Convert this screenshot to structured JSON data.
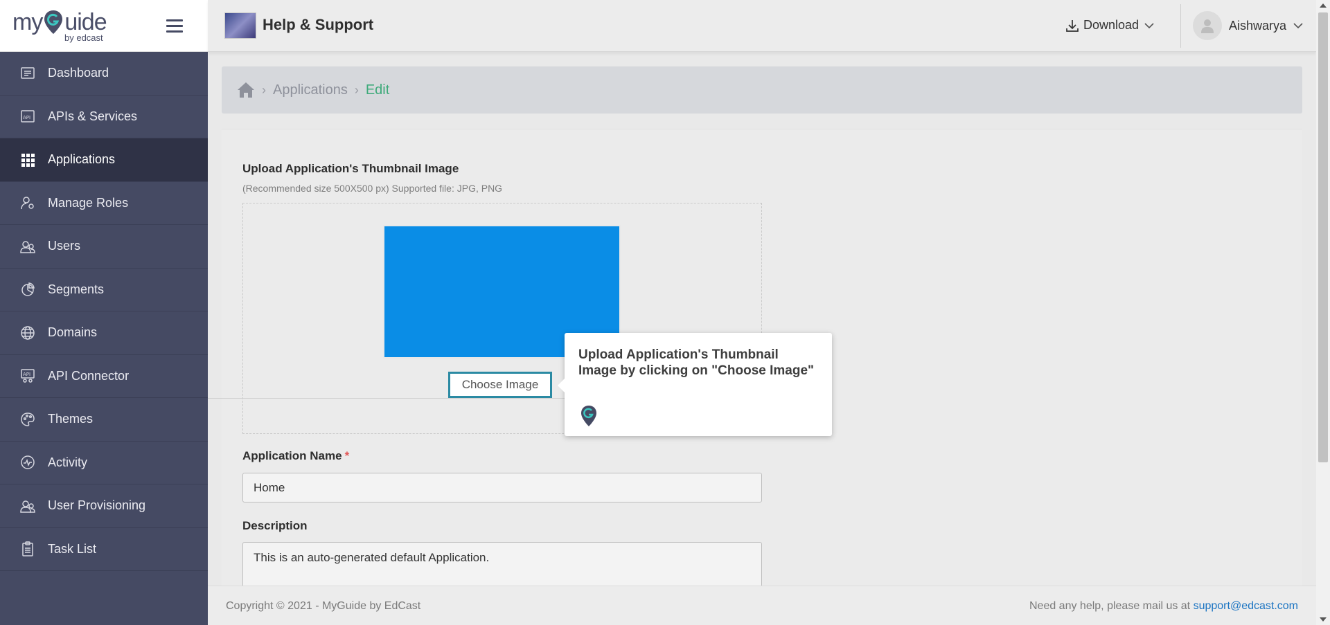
{
  "brand": {
    "logo_text_pre": "my",
    "logo_text_post": "uide",
    "logo_sub": "by edcast"
  },
  "sidebar": {
    "items": [
      {
        "label": "Dashboard",
        "icon": "dashboard-icon"
      },
      {
        "label": "APIs & Services",
        "icon": "api-icon"
      },
      {
        "label": "Applications",
        "icon": "grid-icon",
        "active": true
      },
      {
        "label": "Manage Roles",
        "icon": "user-gear-icon"
      },
      {
        "label": "Users",
        "icon": "users-icon"
      },
      {
        "label": "Segments",
        "icon": "pie-icon"
      },
      {
        "label": "Domains",
        "icon": "globe-icon"
      },
      {
        "label": "API Connector",
        "icon": "api-connector-icon"
      },
      {
        "label": "Themes",
        "icon": "palette-icon"
      },
      {
        "label": "Activity",
        "icon": "activity-icon"
      },
      {
        "label": "User Provisioning",
        "icon": "users-icon"
      },
      {
        "label": "Task List",
        "icon": "clipboard-icon"
      }
    ]
  },
  "header": {
    "title": "Help & Support",
    "download_label": "Download",
    "user_name": "Aishwarya"
  },
  "breadcrumb": {
    "link": "Applications",
    "current": "Edit"
  },
  "form": {
    "upload_title": "Upload Application's Thumbnail Image",
    "upload_hint": "(Recommended size 500X500 px) Supported file: JPG, PNG",
    "choose_label": "Choose Image",
    "name_label": "Application Name",
    "required_mark": "*",
    "name_value": "Home",
    "desc_label": "Description",
    "desc_value": "This is an auto-generated default Application."
  },
  "tooltip": {
    "text": "Upload Application's Thumbnail Image by clicking on \"Choose Image\""
  },
  "footer": {
    "copyright": "Copyright © 2021 - MyGuide by EdCast",
    "help_text": "Need any help, please mail us at",
    "help_email": "support@edcast.com"
  },
  "colors": {
    "sidebar_bg": "#454a63",
    "active_bg": "#2f3246",
    "accent_green": "#3eaa7a",
    "thumb_blue": "#0a8de6",
    "link_blue": "#1b74c2"
  }
}
